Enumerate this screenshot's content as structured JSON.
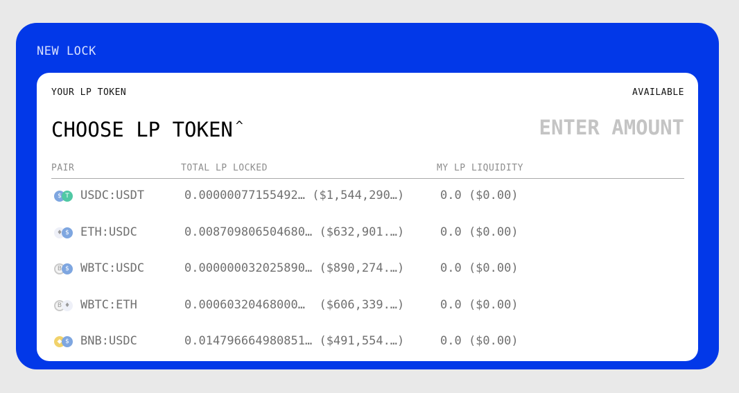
{
  "panel": {
    "title": "NEW LOCK"
  },
  "card": {
    "token_label": "YOUR LP TOKEN",
    "available_label": "AVAILABLE",
    "choose_label": "CHOOSE LP TOKEN",
    "caret": "^",
    "amount_placeholder": "ENTER AMOUNT"
  },
  "table": {
    "headers": [
      "PAIR",
      "TOTAL LP LOCKED",
      "MY LP LIQUIDITY"
    ],
    "rows": [
      {
        "pair": "USDC:USDT",
        "locked": "0.00000077155492… ($1,544,290…)",
        "mine": "0.0 ($0.00)",
        "icons": [
          {
            "name": "usdc-icon",
            "bg": "#7ea6e0",
            "border": "#7ea6e0",
            "glyph": "$"
          },
          {
            "name": "usdt-icon",
            "bg": "#50c8a4",
            "border": "#50c8a4",
            "glyph": "T"
          }
        ]
      },
      {
        "pair": "ETH:USDC",
        "locked": "0.008709806504680… ($632,901.…)",
        "mine": "0.0 ($0.00)",
        "icons": [
          {
            "name": "eth-icon",
            "bg": "#eef0f8",
            "border": "#eef0f8",
            "glyph": "♦"
          },
          {
            "name": "usdc-icon",
            "bg": "#7ea6e0",
            "border": "#7ea6e0",
            "glyph": "$"
          }
        ]
      },
      {
        "pair": "WBTC:USDC",
        "locked": "0.000000032025890… ($890,274.…)",
        "mine": "0.0 ($0.00)",
        "icons": [
          {
            "name": "wbtc-icon",
            "bg": "#f4f4f4",
            "border": "#c9c9c9",
            "glyph": "B"
          },
          {
            "name": "usdc-icon",
            "bg": "#7ea6e0",
            "border": "#7ea6e0",
            "glyph": "$"
          }
        ]
      },
      {
        "pair": "WBTC:ETH",
        "locked": "0.00060320468000…  ($606,339.…)",
        "mine": "0.0 ($0.00)",
        "icons": [
          {
            "name": "wbtc-icon",
            "bg": "#f4f4f4",
            "border": "#c9c9c9",
            "glyph": "B"
          },
          {
            "name": "eth-icon",
            "bg": "#eef0f8",
            "border": "#eef0f8",
            "glyph": "♦"
          }
        ]
      },
      {
        "pair": "BNB:USDC",
        "locked": "0.014796664980851… ($491,554.…)",
        "mine": "0.0 ($0.00)",
        "icons": [
          {
            "name": "bnb-icon",
            "bg": "#f1d26b",
            "border": "#f1d26b",
            "glyph": "◆"
          },
          {
            "name": "usdc-icon",
            "bg": "#7ea6e0",
            "border": "#7ea6e0",
            "glyph": "$"
          }
        ]
      }
    ]
  },
  "colors": {
    "panel_bg": "#0238e8",
    "card_bg": "#ffffff",
    "page_bg": "#e9e9e9",
    "muted_text": "#707070",
    "placeholder_text": "#c4c4c4"
  }
}
